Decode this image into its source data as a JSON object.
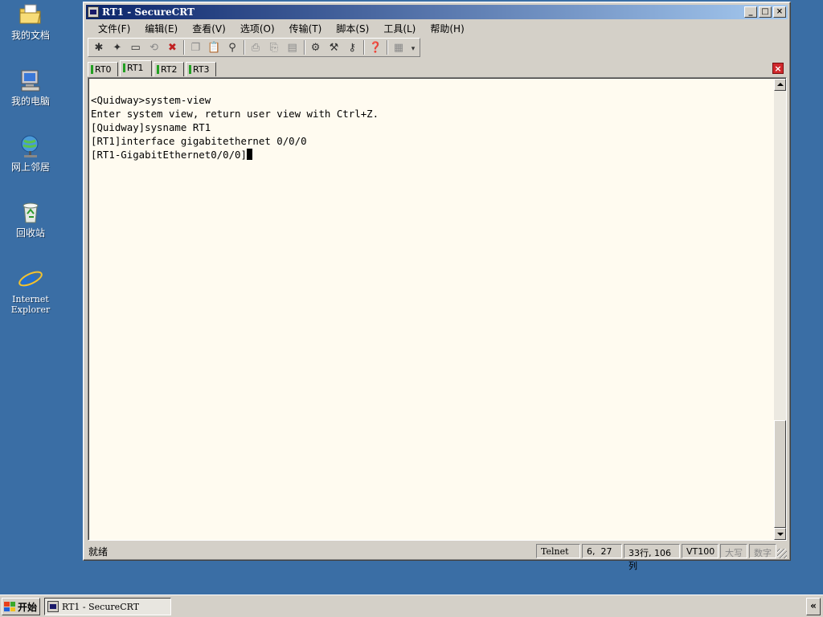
{
  "desktop": {
    "icons": [
      {
        "label": "我的文档",
        "icon": "my-documents-icon"
      },
      {
        "label": "我的电脑",
        "icon": "my-computer-icon"
      },
      {
        "label": "网上邻居",
        "icon": "network-places-icon"
      },
      {
        "label": "回收站",
        "icon": "recycle-bin-icon"
      },
      {
        "label": "Internet\nExplorer",
        "icon": "internet-explorer-icon"
      }
    ]
  },
  "window": {
    "title": "RT1 - SecureCRT",
    "controls": {
      "minimize": "_",
      "maximize": "□",
      "close": "×"
    },
    "menu": [
      "文件(F)",
      "编辑(E)",
      "查看(V)",
      "选项(O)",
      "传输(T)",
      "脚本(S)",
      "工具(L)",
      "帮助(H)"
    ],
    "tabs": [
      "RT0",
      "RT1",
      "RT2",
      "RT3"
    ],
    "active_tab": "RT1",
    "terminal_lines": [
      "<Quidway>system-view",
      "Enter system view, return user view with Ctrl+Z.",
      "[Quidway]sysname RT1",
      "[RT1]interface gigabitethernet 0/0/0",
      "[RT1-GigabitEthernet0/0/0]"
    ],
    "status": {
      "text": "就绪",
      "protocol": "Telnet",
      "cursor_pos": "6,  27",
      "size": "33行, 106列",
      "emulation": "VT100",
      "caps": "大写",
      "num": "数字"
    }
  },
  "taskbar": {
    "start_label": "开始",
    "task_title": "RT1 - SecureCRT",
    "tray_toggle": "«"
  },
  "colors": {
    "desktop": "#3a6ea5",
    "title_start": "#0a246a",
    "title_end": "#a6caf0",
    "terminal_bg": "#fffbf0"
  }
}
